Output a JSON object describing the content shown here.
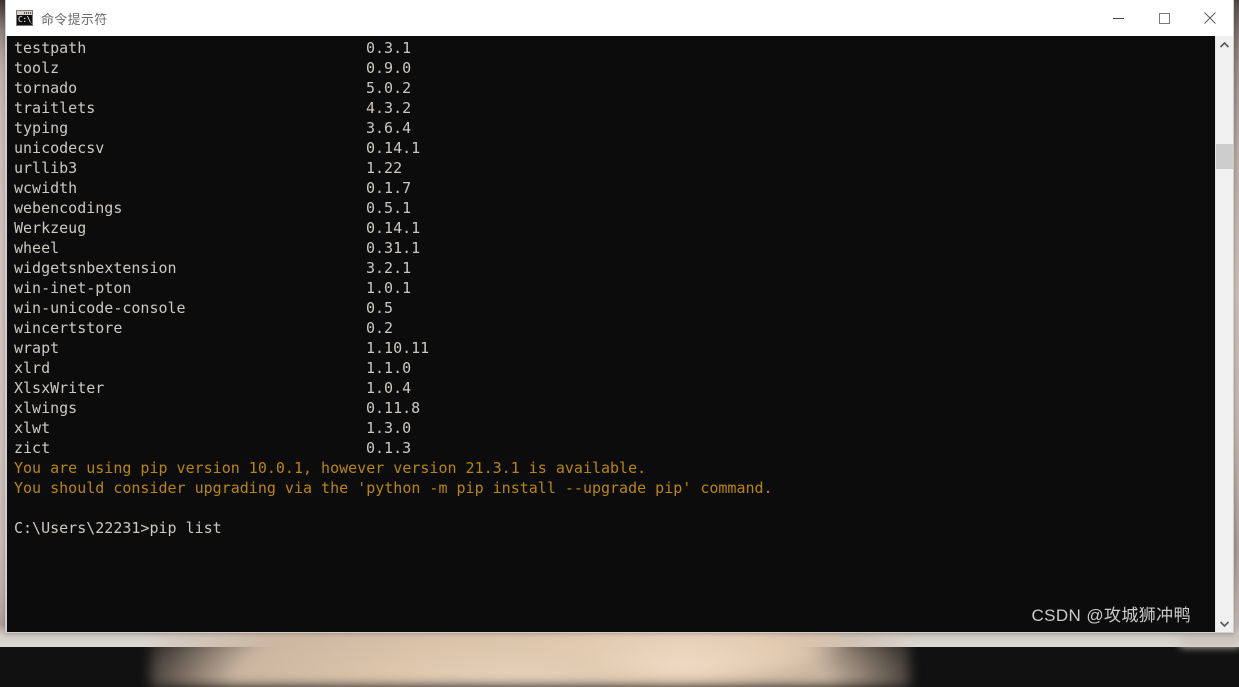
{
  "window": {
    "title": "命令提示符",
    "icon": "cmd-console-icon",
    "icon_text": "C:\\_",
    "controls": {
      "minimize_label": "—",
      "maximize_label": "□",
      "close_label": "✕"
    }
  },
  "console": {
    "background_color": "#0c0c0c",
    "foreground_color": "#ccc8c4",
    "warning_color": "#b8860b",
    "packages": [
      {
        "name": "testpath",
        "version": "0.3.1"
      },
      {
        "name": "toolz",
        "version": "0.9.0"
      },
      {
        "name": "tornado",
        "version": "5.0.2"
      },
      {
        "name": "traitlets",
        "version": "4.3.2"
      },
      {
        "name": "typing",
        "version": "3.6.4"
      },
      {
        "name": "unicodecsv",
        "version": "0.14.1"
      },
      {
        "name": "urllib3",
        "version": "1.22"
      },
      {
        "name": "wcwidth",
        "version": "0.1.7"
      },
      {
        "name": "webencodings",
        "version": "0.5.1"
      },
      {
        "name": "Werkzeug",
        "version": "0.14.1"
      },
      {
        "name": "wheel",
        "version": "0.31.1"
      },
      {
        "name": "widgetsnbextension",
        "version": "3.2.1"
      },
      {
        "name": "win-inet-pton",
        "version": "1.0.1"
      },
      {
        "name": "win-unicode-console",
        "version": "0.5"
      },
      {
        "name": "wincertstore",
        "version": "0.2"
      },
      {
        "name": "wrapt",
        "version": "1.10.11"
      },
      {
        "name": "xlrd",
        "version": "1.1.0"
      },
      {
        "name": "XlsxWriter",
        "version": "1.0.4"
      },
      {
        "name": "xlwings",
        "version": "0.11.8"
      },
      {
        "name": "xlwt",
        "version": "1.3.0"
      },
      {
        "name": "zict",
        "version": "0.1.3"
      }
    ],
    "warnings": [
      "You are using pip version 10.0.1, however version 21.3.1 is available.",
      "You should consider upgrading via the 'python -m pip install --upgrade pip' command."
    ],
    "prompt": "C:\\Users\\22231>pip list"
  },
  "scrollbar": {
    "up_arrow": "scroll-up-arrow-icon",
    "down_arrow": "scroll-down-arrow-icon"
  },
  "watermark": {
    "text": "CSDN @攻城狮冲鸭"
  }
}
